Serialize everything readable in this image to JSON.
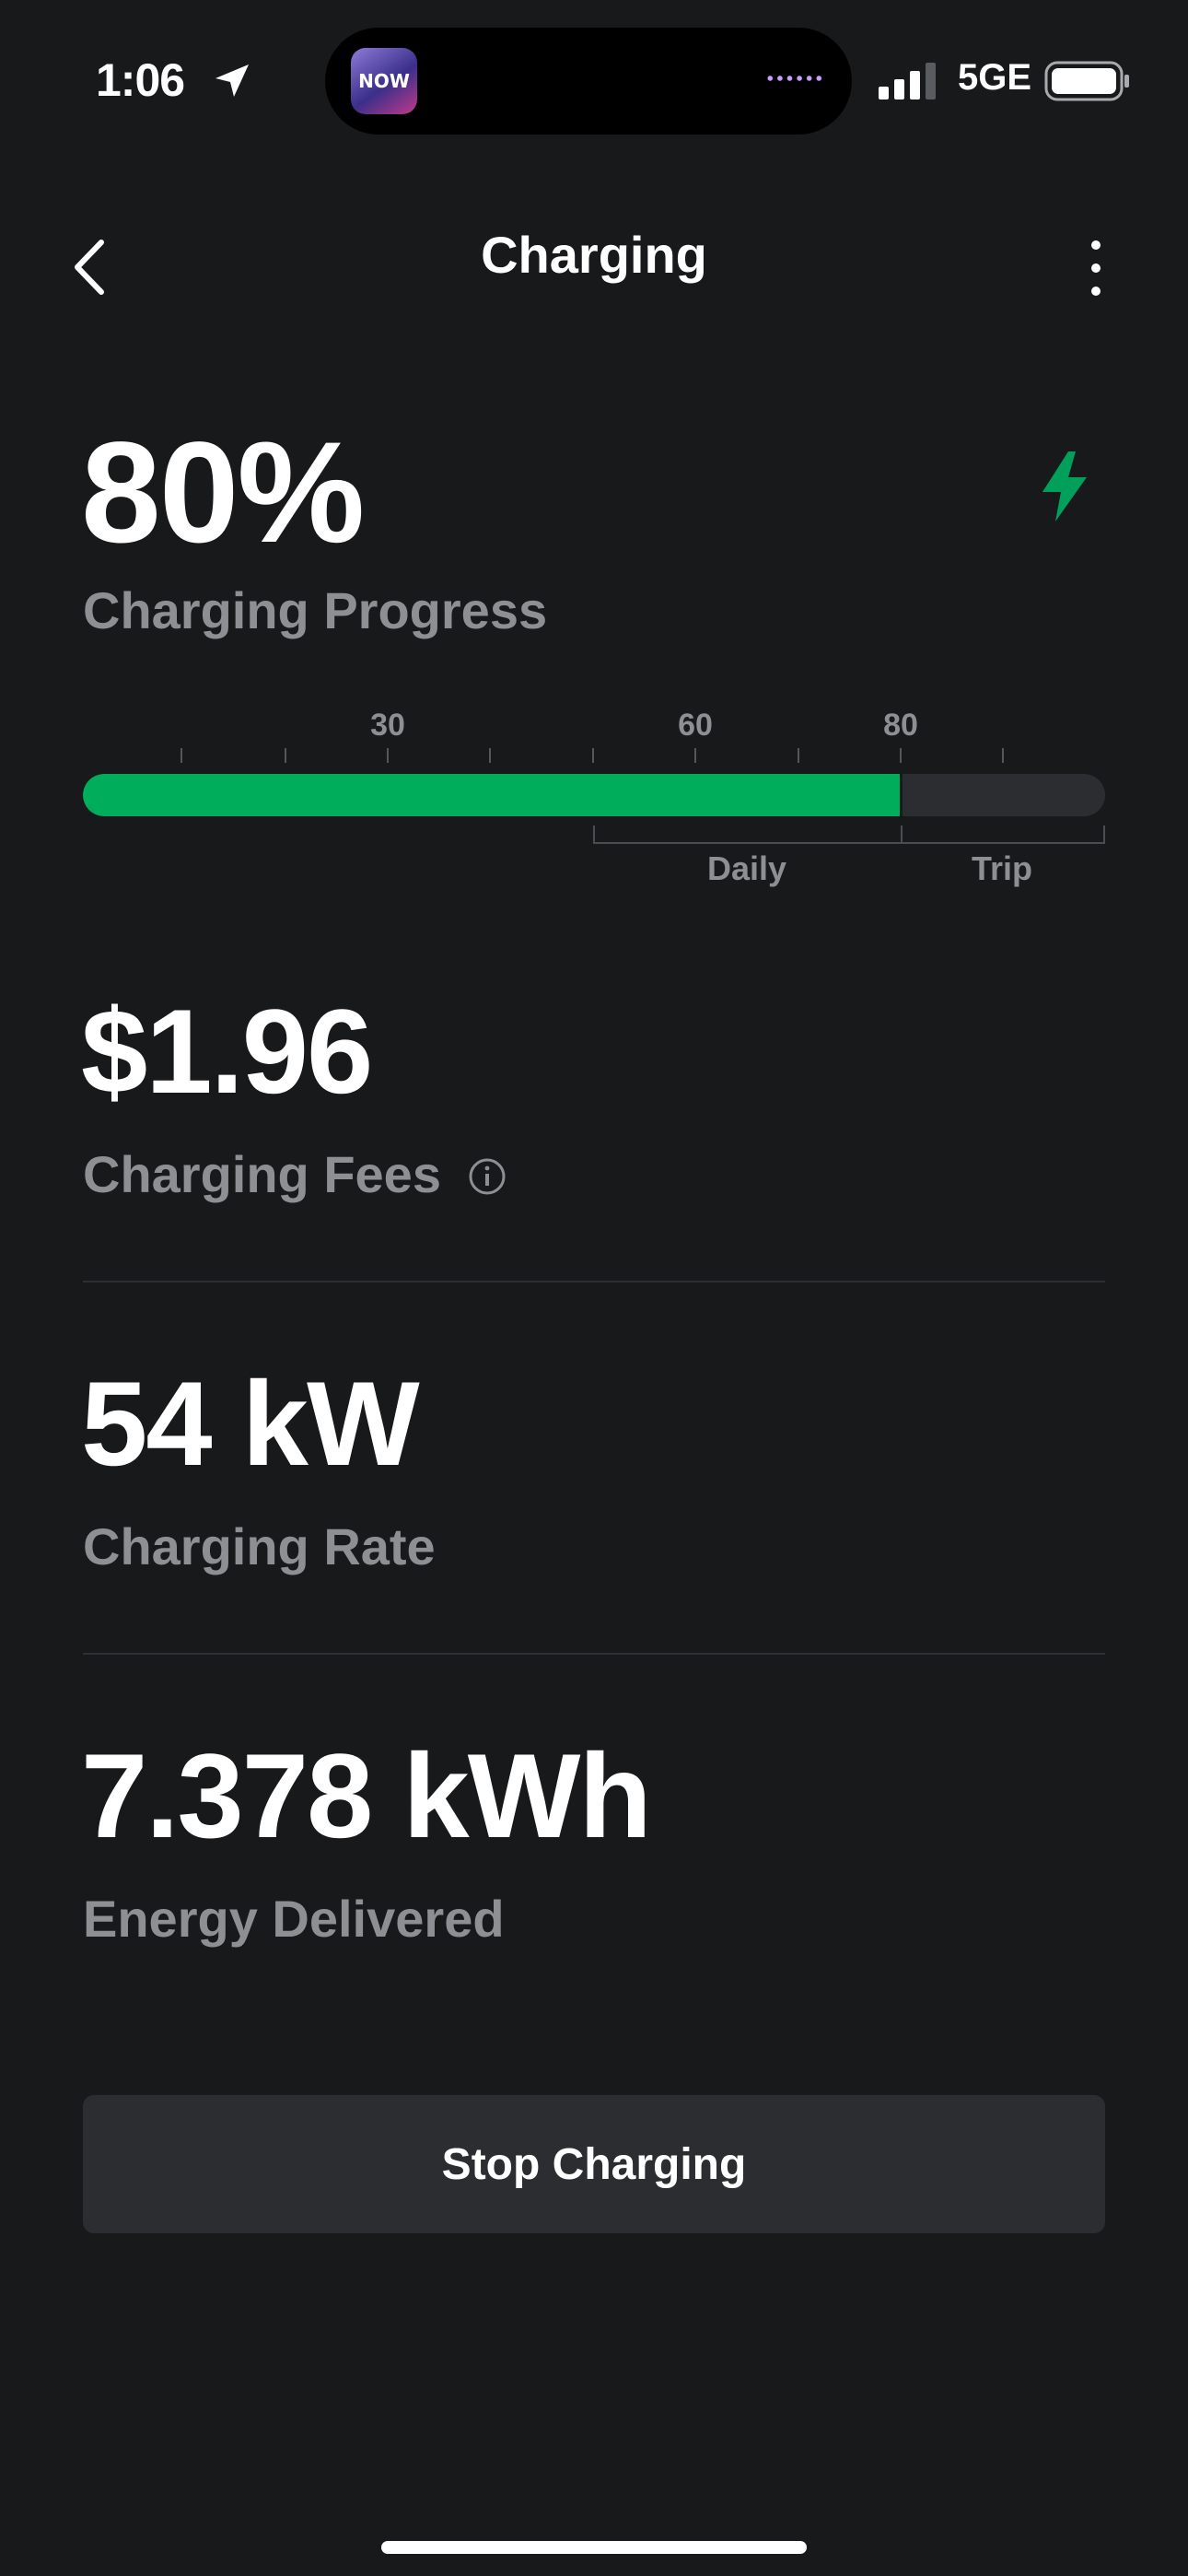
{
  "status_bar": {
    "time": "1:06",
    "network": "5GE",
    "island_app": "NOW",
    "icons": [
      "location-arrow-icon",
      "signal-bars-icon",
      "battery-icon"
    ]
  },
  "header": {
    "title": "Charging",
    "icons": [
      "chevron-left-icon",
      "more-vertical-icon"
    ]
  },
  "progress": {
    "value": "80%",
    "percent": 80,
    "label": "Charging Progress",
    "icon": "lightning-bolt-icon",
    "accent_color": "#00ad5b",
    "tick_labels": [
      "30",
      "60",
      "80"
    ],
    "range_labels": [
      "Daily",
      "Trip"
    ]
  },
  "fees": {
    "value": "$1.96",
    "label": "Charging Fees",
    "icon": "info-circle-icon"
  },
  "rate": {
    "value": "54 kW",
    "label": "Charging Rate"
  },
  "energy": {
    "value": "7.378 kWh",
    "label": "Energy Delivered"
  },
  "action": {
    "stop_label": "Stop Charging"
  }
}
